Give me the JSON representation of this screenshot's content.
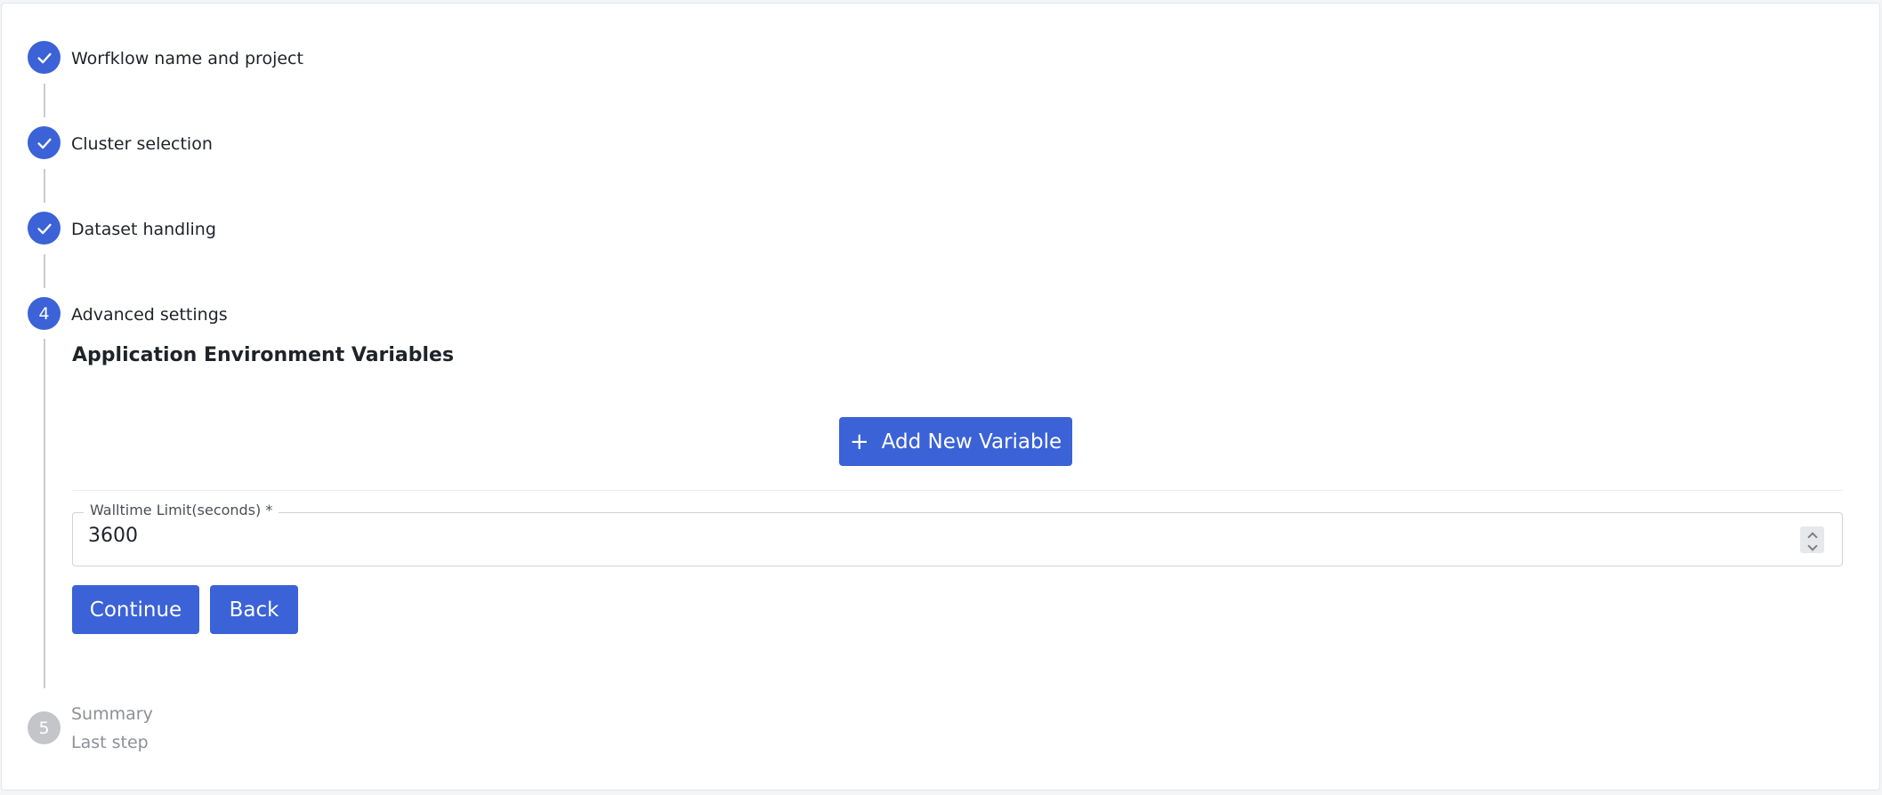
{
  "steps": [
    {
      "label": "Worfklow name and project",
      "status": "done",
      "icon": "check-icon"
    },
    {
      "label": "Cluster selection",
      "status": "done",
      "icon": "check-icon"
    },
    {
      "label": "Dataset handling",
      "status": "done",
      "icon": "check-icon"
    },
    {
      "label": "Advanced settings",
      "status": "active",
      "number": "4"
    },
    {
      "label": "Summary",
      "status": "pending",
      "number": "5",
      "sublabel": "Last step"
    }
  ],
  "advanced": {
    "section_title": "Application Environment Variables",
    "add_variable_label": "Add New Variable",
    "add_variable_icon": "+",
    "walltime_label": "Walltime Limit(seconds) *",
    "walltime_value": "3600"
  },
  "actions": {
    "continue_label": "Continue",
    "back_label": "Back"
  },
  "colors": {
    "primary": "#3b62d6",
    "pending": "#c3c5c9",
    "connector": "#c8cbd0"
  }
}
